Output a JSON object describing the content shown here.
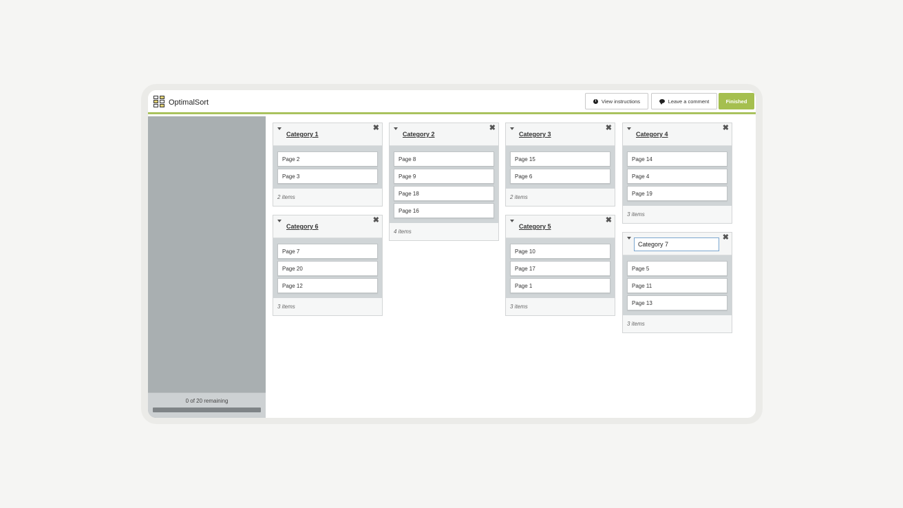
{
  "app": {
    "name": "OptimalSort",
    "buttons": {
      "instructions": "View instructions",
      "comment": "Leave a comment",
      "finished": "Finished"
    }
  },
  "sidebar": {
    "remaining_text": "0 of 20 remaining",
    "progress_fraction": 1.0
  },
  "categories": [
    {
      "title": "Category 1",
      "items": [
        "Page 2",
        "Page 3"
      ],
      "count_label": "2 items"
    },
    {
      "title": "Category 2",
      "items": [
        "Page 8",
        "Page 9",
        "Page 18",
        "Page 16"
      ],
      "count_label": "4 items"
    },
    {
      "title": "Category 3",
      "items": [
        "Page 15",
        "Page 6"
      ],
      "count_label": "2 items"
    },
    {
      "title": "Category 4",
      "items": [
        "Page 14",
        "Page 4",
        "Page 19"
      ],
      "count_label": "3 items"
    },
    {
      "title": "Category 6",
      "items": [
        "Page 7",
        "Page 20",
        "Page 12"
      ],
      "count_label": "3 items"
    },
    {
      "title": "Category 5",
      "items": [
        "Page 10",
        "Page 17",
        "Page 1"
      ],
      "count_label": "3 items"
    },
    {
      "title": "Category 7",
      "items": [
        "Page 5",
        "Page 11",
        "Page 13"
      ],
      "count_label": "3 items",
      "editing": true
    }
  ],
  "icons": {
    "info": "info-circle-icon",
    "comment": "speech-bubble-icon",
    "caret": "caret-down-icon",
    "close": "close-x-icon"
  },
  "colors": {
    "accent": "#a5bf4f",
    "sidebar": "#a9afb1"
  }
}
